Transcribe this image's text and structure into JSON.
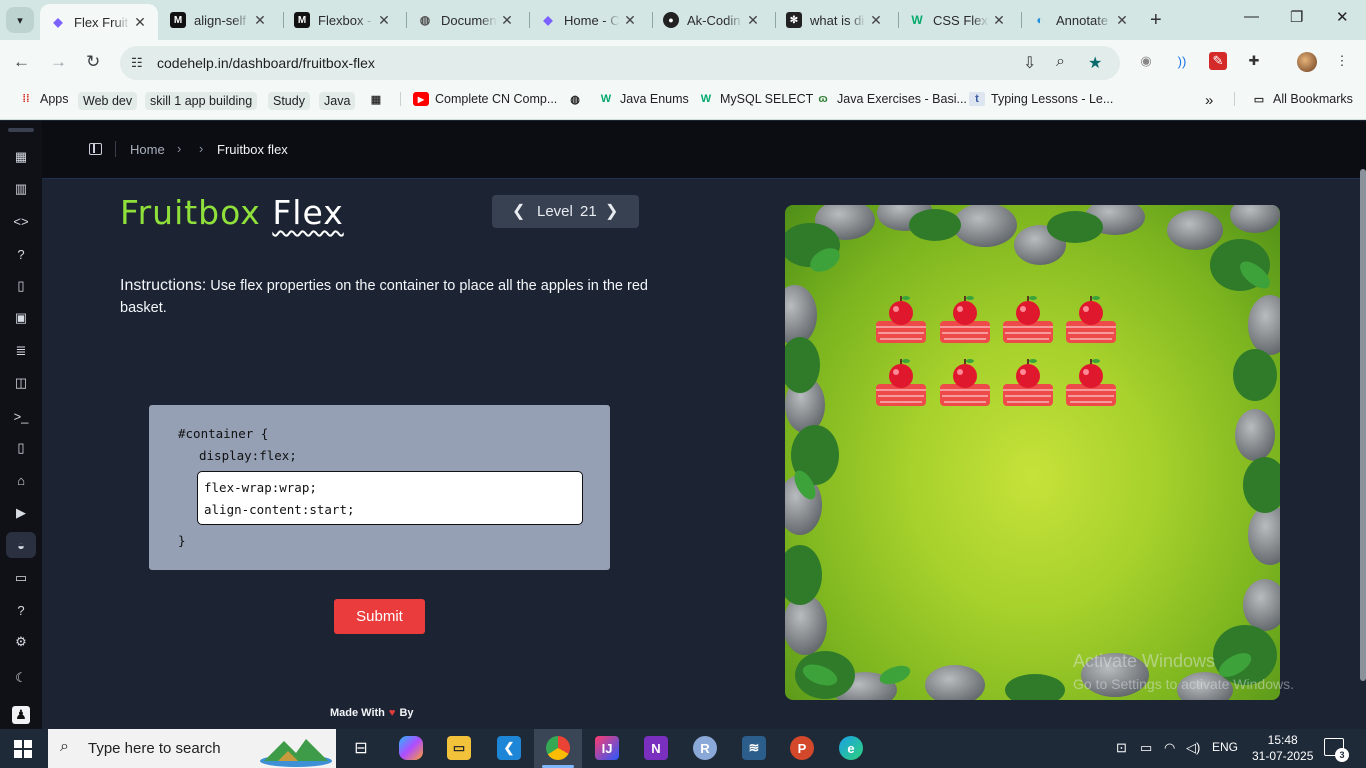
{
  "browser": {
    "tabs": [
      {
        "title": "Flex Fruit",
        "active": true,
        "icon": "codehelp-icon"
      },
      {
        "title": "align-self",
        "active": false,
        "icon": "mdn-icon"
      },
      {
        "title": "Flexbox -",
        "active": false,
        "icon": "mdn-icon"
      },
      {
        "title": "Documen",
        "active": false,
        "icon": "globe-icon"
      },
      {
        "title": "Home - C",
        "active": false,
        "icon": "codehelp-icon"
      },
      {
        "title": "Ak-Codin",
        "active": false,
        "icon": "github-icon"
      },
      {
        "title": "what is di",
        "active": false,
        "icon": "chatgpt-icon"
      },
      {
        "title": "CSS Flexb",
        "active": false,
        "icon": "w3schools-icon"
      },
      {
        "title": "Annotate",
        "active": false,
        "icon": "edge-icon"
      }
    ],
    "url": "codehelp.in/dashboard/fruitbox-flex",
    "bookmarks": [
      {
        "label": "Apps",
        "icon": "apps-grid-icon"
      },
      {
        "label": "Web dev",
        "icon": ""
      },
      {
        "label": "skill 1 app building",
        "icon": ""
      },
      {
        "label": "Study",
        "icon": ""
      },
      {
        "label": "Java",
        "icon": ""
      },
      {
        "label": "",
        "icon": "tab-groups-icon"
      },
      {
        "label": "Complete CN Comp...",
        "icon": "youtube-icon"
      },
      {
        "label": "",
        "icon": "globe-icon"
      },
      {
        "label": "Java Enums",
        "icon": "w3schools-icon"
      },
      {
        "label": "MySQL SELECT",
        "icon": "w3schools-icon"
      },
      {
        "label": "Java Exercises - Basi...",
        "icon": "w3resource-icon"
      },
      {
        "label": "Typing Lessons - Le...",
        "icon": "typing-icon"
      }
    ],
    "all_bookmarks": "All Bookmarks"
  },
  "breadcrumb": {
    "home": "Home",
    "current": "Fruitbox flex"
  },
  "game": {
    "title_part1": "Fruitbox",
    "title_part2": "Flex",
    "level_label": "Level",
    "level_number": "21",
    "instructions_label": "Instructions:",
    "instructions_text": "Use flex properties on the container to place all the apples in the red basket.",
    "code_open": "#container {",
    "code_fixed": "display:flex;",
    "code_input_lines": [
      "flex-wrap:wrap;",
      "align-content:start;"
    ],
    "code_close": "}",
    "submit_label": "Submit",
    "footer_made": "Made With",
    "footer_by": "By",
    "baskets_rows": 2,
    "baskets_per_row": 4
  },
  "system": {
    "watermark_title": "Activate Windows",
    "watermark_sub": "Go to Settings to activate Windows.",
    "search_placeholder": "Type here to search",
    "language": "ENG",
    "time": "15:48",
    "date": "31-07-2025",
    "notifications": "3"
  },
  "colors": {
    "accent_green": "#8fe03a",
    "submit_red": "#ea3c3c",
    "page_bg": "#1c2434"
  }
}
